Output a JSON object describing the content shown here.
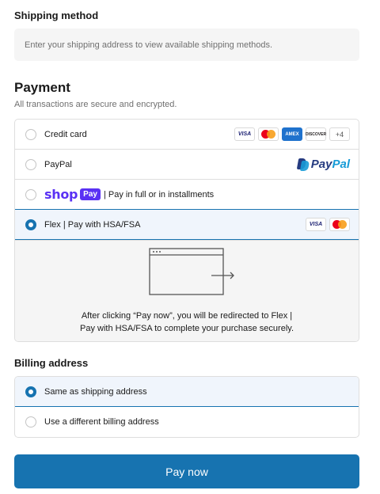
{
  "shipping": {
    "title": "Shipping method",
    "placeholder_text": "Enter your shipping address to view available shipping methods."
  },
  "payment": {
    "title": "Payment",
    "subtitle": "All transactions are secure and encrypted.",
    "options": [
      {
        "label": "Credit card",
        "selected": false,
        "card_icons": [
          "VISA",
          "mastercard",
          "AMEX",
          "DISCOVER",
          "+4"
        ]
      },
      {
        "label": "PayPal",
        "selected": false,
        "logo": {
          "pay": "Pay",
          "pal": "Pal"
        }
      },
      {
        "label": "| Pay in full or in installments",
        "selected": false,
        "logo": {
          "shop": "shop",
          "pay": "Pay"
        }
      },
      {
        "label": "Flex | Pay with HSA/FSA",
        "selected": true,
        "card_icons": [
          "VISA",
          "mastercard"
        ]
      }
    ],
    "redirect_text_line1": "After clicking “Pay now”, you will be redirected to Flex |",
    "redirect_text_line2": "Pay with HSA/FSA to complete your purchase securely."
  },
  "billing": {
    "title": "Billing address",
    "options": [
      {
        "label": "Same as shipping address",
        "selected": true
      },
      {
        "label": "Use a different billing address",
        "selected": false
      }
    ]
  },
  "pay_button": {
    "label": "Pay now"
  },
  "colors": {
    "accent": "#1773b0",
    "selected_bg": "#f0f5fc",
    "shop_purple": "#5a31f4",
    "paypal_dark": "#253b80",
    "paypal_light": "#179bd7"
  }
}
